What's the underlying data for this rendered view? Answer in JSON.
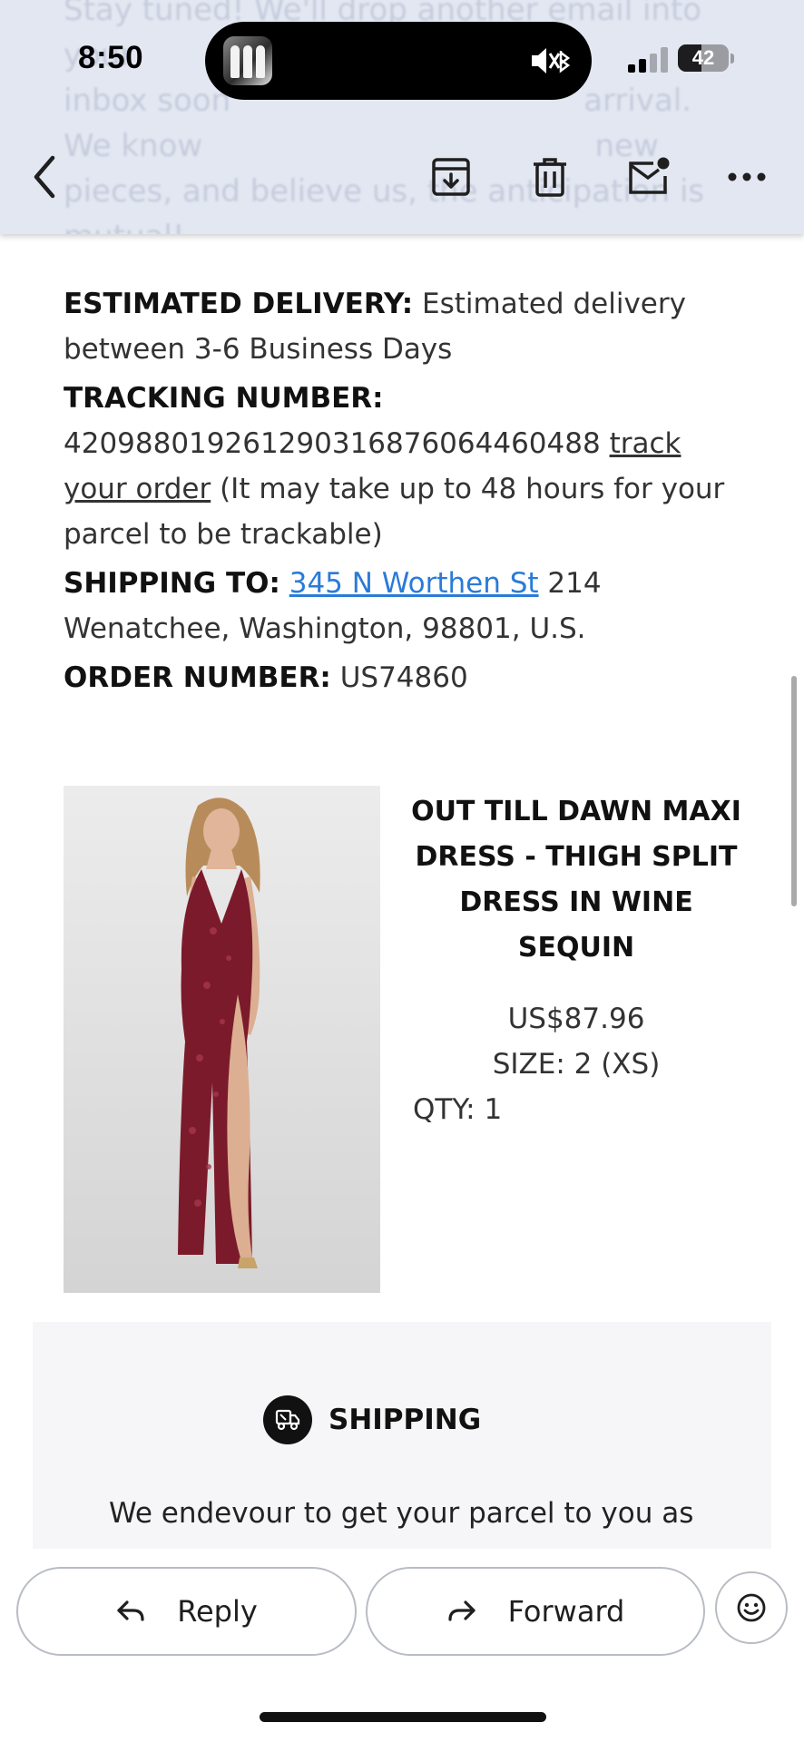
{
  "status": {
    "time": "8:50",
    "battery": "42"
  },
  "header_ghost": {
    "lines": [
      "Stay tuned! We'll drop another email into your",
      "inbox soon                                    arrival.",
      "We know                                        new",
      "pieces, and believe us, the anticipation is",
      "mutual!"
    ]
  },
  "order": {
    "estimated_delivery_label": "ESTIMATED DELIVERY:",
    "estimated_delivery_value": " Estimated delivery between 3-6 Business Days",
    "tracking_label": "TRACKING NUMBER:",
    "tracking_number": "420988019261290316876064460488",
    "track_link": "track your order",
    "tracking_note": " (It may take up to 48 hours for your parcel to be trackable)",
    "shipping_to_label": "SHIPPING TO:",
    "shipping_street_link": "345 N Worthen St",
    "shipping_rest": " 214 Wenatchee, Washington, 98801, U.S.",
    "order_number_label": "ORDER NUMBER:",
    "order_number": " US74860"
  },
  "product": {
    "name": "OUT TILL DAWN MAXI DRESS - THIGH SPLIT DRESS IN WINE SEQUIN",
    "price": "US$87.96",
    "size": "SIZE: 2 (XS)",
    "qty": "QTY: 1",
    "dress_color": "#7b1a2a"
  },
  "shipping_section": {
    "title": "SHIPPING",
    "text": "We endevour to get your parcel to you as"
  },
  "actions": {
    "reply": "Reply",
    "forward": "Forward"
  },
  "colors": {
    "header_bg": "#e3e7f1",
    "link_blue": "#2a7bd8"
  }
}
